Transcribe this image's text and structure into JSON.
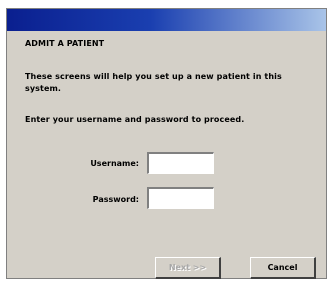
{
  "dialog": {
    "heading": "ADMIT A PATIENT",
    "intro": "These screens will help you set up a new patient in this system.",
    "instruction": "Enter your username and password to proceed."
  },
  "form": {
    "username_label": "Username:",
    "username_value": "",
    "password_label": "Password:",
    "password_value": ""
  },
  "buttons": {
    "next_label": "Next >>",
    "next_enabled": false,
    "cancel_label": "Cancel"
  },
  "colors": {
    "titlebar_start": "#0a1f8f",
    "titlebar_end": "#a9c4e8",
    "dialog_bg": "#d4d0c8"
  }
}
